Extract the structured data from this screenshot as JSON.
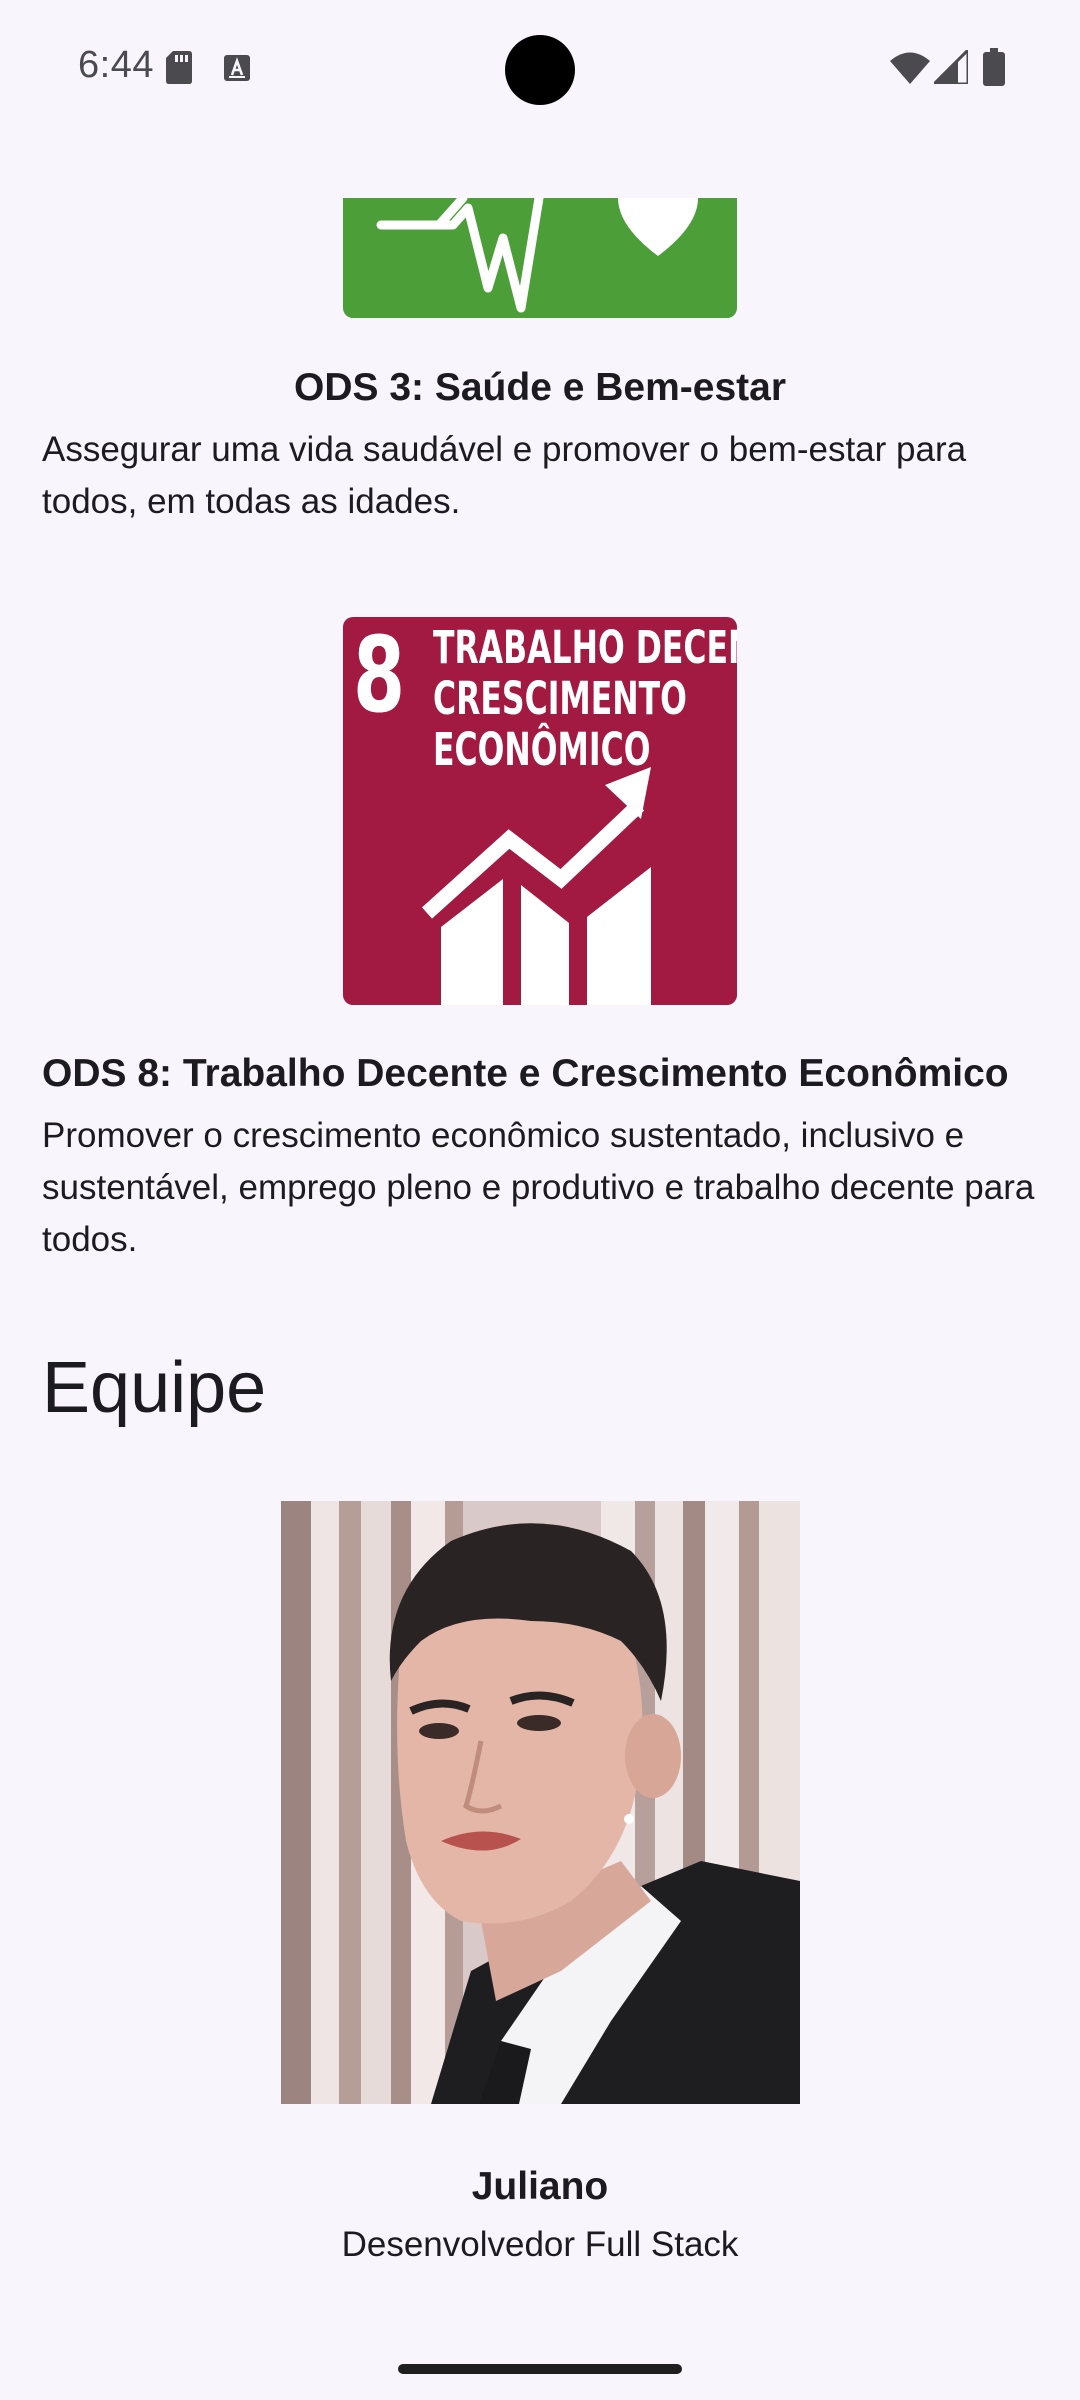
{
  "status_bar": {
    "time": "6:44",
    "icons": [
      "sd-card-icon",
      "text-a-icon",
      "wifi-icon",
      "signal-icon",
      "battery-icon"
    ]
  },
  "ods_items": [
    {
      "title": "ODS 3: Saúde e Bem-estar",
      "description": "Assegurar uma vida saudável e promover o bem-estar para todos, em todas as idades.",
      "image_color": "#4c9f38"
    },
    {
      "title": "ODS 8: Trabalho Decente e Crescimento Econômico",
      "description": "Promover o crescimento econômico sustentado, inclusivo e sustentável, emprego pleno e produtivo e trabalho decente para todos.",
      "image_color": "#a21942",
      "image_number": "8",
      "image_label_lines": [
        "TRABALHO DECENTE E",
        "CRESCIMENTO",
        "ECONÔMICO"
      ]
    }
  ],
  "team": {
    "heading": "Equipe",
    "members": [
      {
        "name": "Juliano",
        "role": "Desenvolvedor Full Stack"
      }
    ]
  }
}
